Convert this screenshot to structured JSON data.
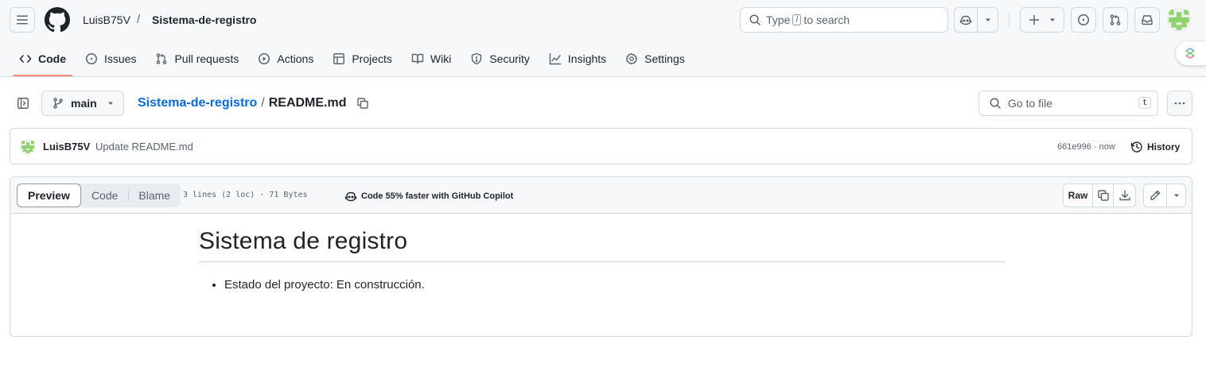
{
  "header": {
    "owner": "LuisB75V",
    "slash": "/",
    "repo": "Sistema-de-registro",
    "search_prefix": "Type",
    "search_key": "/",
    "search_suffix": "to search"
  },
  "tabs": [
    {
      "label": "Code",
      "icon": "code-icon",
      "active": true
    },
    {
      "label": "Issues",
      "icon": "issue-opened-icon"
    },
    {
      "label": "Pull requests",
      "icon": "git-pull-request-icon"
    },
    {
      "label": "Actions",
      "icon": "play-icon"
    },
    {
      "label": "Projects",
      "icon": "table-icon"
    },
    {
      "label": "Wiki",
      "icon": "book-icon"
    },
    {
      "label": "Security",
      "icon": "shield-icon"
    },
    {
      "label": "Insights",
      "icon": "graph-icon"
    },
    {
      "label": "Settings",
      "icon": "gear-icon"
    }
  ],
  "file_header": {
    "branch": "main",
    "repo_link": "Sistema-de-registro",
    "separator": "/",
    "file_name": "README.md",
    "go_to_file": "Go to file",
    "go_to_file_key": "t"
  },
  "commit": {
    "author": "LuisB75V",
    "message": "Update README.md",
    "hash_time": "661e996 · now",
    "history": "History"
  },
  "file_toolbar": {
    "preview": "Preview",
    "code": "Code",
    "blame": "Blame",
    "meta": "3 lines (2 loc) · 71 Bytes",
    "copilot_promo": "Code 55% faster with GitHub Copilot",
    "raw": "Raw"
  },
  "readme": {
    "title": "Sistema de registro",
    "items": [
      "Estado del proyecto: En construcción."
    ]
  },
  "colors": {
    "accent_link": "#0969da",
    "active_tab_underline": "#fd8c73",
    "avatar_green": "#8fd36b"
  }
}
